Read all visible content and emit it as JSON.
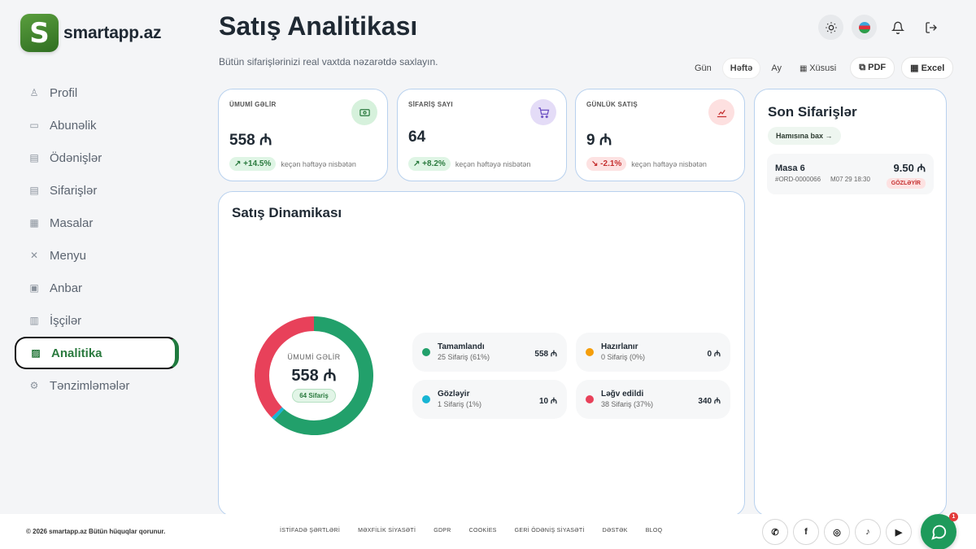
{
  "brand": {
    "logo_letter": "S",
    "name": "smartapp.az"
  },
  "sidebar": {
    "items": [
      {
        "label": "Profil",
        "icon": "user-icon",
        "glyph": "♙"
      },
      {
        "label": "Abunəlik",
        "icon": "monitor-icon",
        "glyph": "▭"
      },
      {
        "label": "Ödənişlər",
        "icon": "receipt-icon",
        "glyph": "▤"
      },
      {
        "label": "Sifarişlər",
        "icon": "clipboard-icon",
        "glyph": "▤"
      },
      {
        "label": "Masalar",
        "icon": "grid-icon",
        "glyph": "▦"
      },
      {
        "label": "Menyu",
        "icon": "utensils-icon",
        "glyph": "✕"
      },
      {
        "label": "Anbar",
        "icon": "archive-icon",
        "glyph": "▣"
      },
      {
        "label": "İşçilər",
        "icon": "briefcase-icon",
        "glyph": "▥"
      },
      {
        "label": "Analitika",
        "icon": "chart-icon",
        "glyph": "▨",
        "active": true
      },
      {
        "label": "Tənzimləmələr",
        "icon": "gear-icon",
        "glyph": "⚙"
      }
    ]
  },
  "header": {
    "title": "Satış Analitikası",
    "subtitle": "Bütün sifarişlərinizi real vaxtda nəzarətdə saxlayın."
  },
  "filters": {
    "periods": [
      "Gün",
      "Həftə",
      "Ay"
    ],
    "active": "Həftə",
    "custom": "Xüsusi",
    "pdf": "PDF",
    "excel": "Excel"
  },
  "stats": [
    {
      "label": "ÜMUMİ GƏLİR",
      "value": "558 ₼",
      "trend": "+14.5%",
      "direction": "up",
      "note": "keçən həftəyə nisbətən",
      "icon": "money-icon",
      "icon_bg": "#d6f1dc",
      "icon_color": "#2a7a3e"
    },
    {
      "label": "SİFARİŞ SAYI",
      "value": "64",
      "trend": "+8.2%",
      "direction": "up",
      "note": "keçən həftəyə nisbətən",
      "icon": "cart-icon",
      "icon_bg": "#e4dcf7",
      "icon_color": "#6b4fc2"
    },
    {
      "label": "GÜNLÜK SATIŞ",
      "value": "9 ₼",
      "trend": "-2.1%",
      "direction": "down",
      "note": "keçən həftəyə nisbətən",
      "icon": "analytics-icon",
      "icon_bg": "#fde0e0",
      "icon_color": "#c53030"
    }
  ],
  "dynamics": {
    "title": "Satış Dinamikası",
    "center_label": "ÜMUMİ GƏLİR",
    "center_value": "558 ₼",
    "center_badge": "64 Sifariş",
    "legend": [
      {
        "name": "Tamamlandı",
        "sub": "25 Sifariş (61%)",
        "value": "558 ₼",
        "color": "#22a06b"
      },
      {
        "name": "Hazırlanır",
        "sub": "0 Sifariş (0%)",
        "value": "0 ₼",
        "color": "#f59e0b"
      },
      {
        "name": "Gözləyir",
        "sub": "1 Sifariş (1%)",
        "value": "10 ₼",
        "color": "#17b5d4"
      },
      {
        "name": "Ləğv edildi",
        "sub": "38 Sifariş (37%)",
        "value": "340 ₼",
        "color": "#e8415a"
      }
    ]
  },
  "chart_data": {
    "type": "pie",
    "title": "Satış Dinamikası",
    "categories": [
      "Tamamlandı",
      "Hazırlanır",
      "Gözləyir",
      "Ləğv edildi"
    ],
    "values": [
      61,
      0,
      1,
      37
    ],
    "colors": [
      "#22a06b",
      "#f59e0b",
      "#17b5d4",
      "#e8415a"
    ]
  },
  "recent_orders": {
    "title": "Son Sifarişlər",
    "see_all": "Hamısına bax",
    "items": [
      {
        "name": "Masa 6",
        "id": "#ORD-0000066",
        "time": "M07 29 18:30",
        "amount": "9.50 ₼",
        "status": "GÖZLƏYİR"
      }
    ]
  },
  "footer": {
    "copyright": "© 2026 smartapp.az Bütün hüquqlar qorunur.",
    "links": [
      "İSTİFADƏ ŞƏRTLƏRİ",
      "MƏXFİLİK SİYASƏTİ",
      "GDPR",
      "COOKİES",
      "GERİ ÖDƏNİŞ SİYASƏTİ",
      "DƏSTƏK",
      "BLOQ"
    ],
    "socials": [
      {
        "name": "whatsapp-icon",
        "glyph": "✆"
      },
      {
        "name": "facebook-icon",
        "glyph": "f"
      },
      {
        "name": "instagram-icon",
        "glyph": "◎"
      },
      {
        "name": "tiktok-icon",
        "glyph": "♪"
      },
      {
        "name": "youtube-icon",
        "glyph": "▶"
      }
    ],
    "chat_badge": "1"
  }
}
